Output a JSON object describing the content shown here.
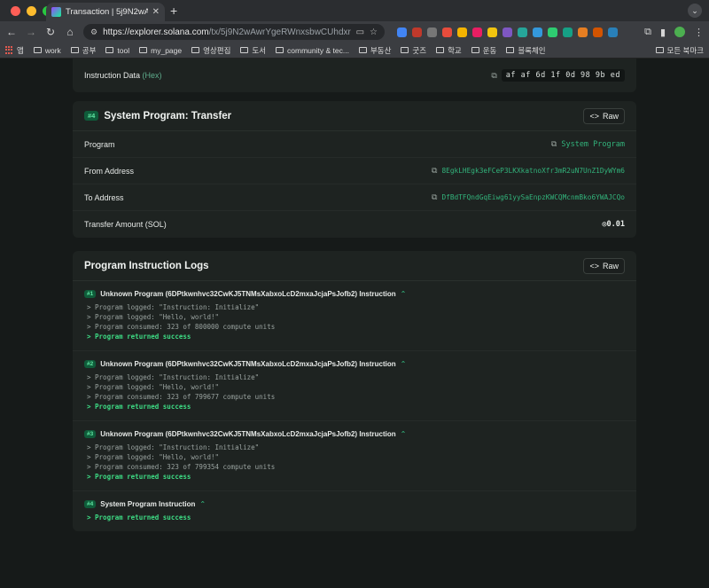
{
  "browser": {
    "tab_title": "Transaction | 5j9N2wAwrYgeR",
    "url_host": "https://explorer.solana.com",
    "url_path": "/tx/5j9N2wAwrYgeRWnxsbwCUhdxr3K5zxMq...",
    "bookmarks": [
      "앱",
      "work",
      "공부",
      "tool",
      "my_page",
      "영상편집",
      "도서",
      "community & tec...",
      "부동산",
      "굿즈",
      "학교",
      "운동",
      "블록체인"
    ],
    "bookmarks_right": "모든 북마크"
  },
  "instruction_data": {
    "label": "Instruction Data",
    "label_suffix": "(Hex)",
    "value": "af af 6d 1f 0d 98 9b ed"
  },
  "transfer_card": {
    "badge": "#4",
    "title": "System Program: Transfer",
    "raw_label": "Raw",
    "rows": [
      {
        "label": "Program",
        "value": "System Program"
      },
      {
        "label": "From Address",
        "value": "8EgkLHEgk3eFCeP3LKXkatnoXfr3mR2uN7UnZ1DyWYm6"
      },
      {
        "label": "To Address",
        "value": "DfBdTFQndGqEiwg61yySaEnpzKWCQMcnmBko6YWAJCQo"
      },
      {
        "label": "Transfer Amount (SOL)",
        "value": "◎0.01"
      }
    ]
  },
  "logs_card": {
    "title": "Program Instruction Logs",
    "raw_label": "Raw",
    "blocks": [
      {
        "badge": "#1",
        "title": "Unknown Program (6DPtkwnhvc32CwKJ5TNMsXabxoLcD2mxaJcjaPsJofb2) Instruction",
        "lines": [
          "> Program logged: \"Instruction: Initialize\"",
          "> Program logged: \"Hello, world!\"",
          "> Program consumed: 323 of 800000 compute units"
        ],
        "success": "> Program returned success"
      },
      {
        "badge": "#2",
        "title": "Unknown Program (6DPtkwnhvc32CwKJ5TNMsXabxoLcD2mxaJcjaPsJofb2) Instruction",
        "lines": [
          "> Program logged: \"Instruction: Initialize\"",
          "> Program logged: \"Hello, world!\"",
          "> Program consumed: 323 of 799677 compute units"
        ],
        "success": "> Program returned success"
      },
      {
        "badge": "#3",
        "title": "Unknown Program (6DPtkwnhvc32CwKJ5TNMsXabxoLcD2mxaJcjaPsJofb2) Instruction",
        "lines": [
          "> Program logged: \"Instruction: Initialize\"",
          "> Program logged: \"Hello, world!\"",
          "> Program consumed: 323 of 799354 compute units"
        ],
        "success": "> Program returned success"
      },
      {
        "badge": "#4",
        "title": "System Program Instruction",
        "lines": [],
        "success": "> Program returned success"
      }
    ]
  }
}
